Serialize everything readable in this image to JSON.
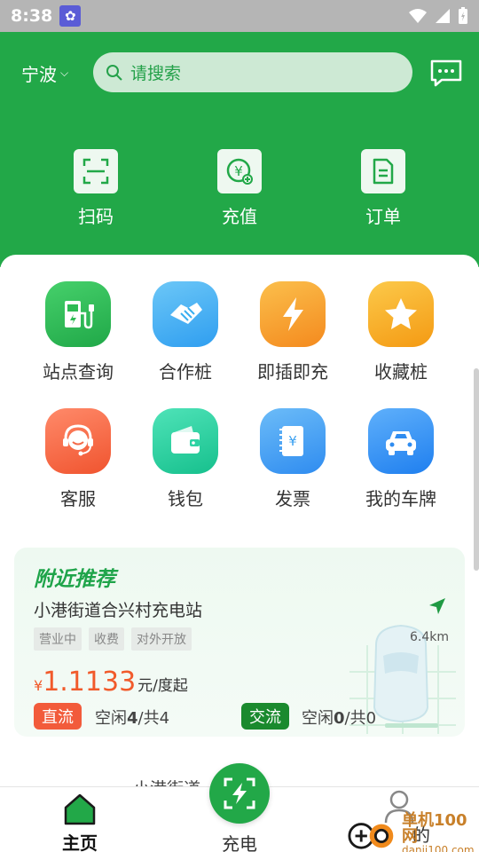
{
  "status_bar": {
    "time": "8:38"
  },
  "header": {
    "city": "宁波",
    "search_placeholder": "请搜索",
    "quick_actions": [
      {
        "label": "扫码",
        "icon": "scan-icon"
      },
      {
        "label": "充值",
        "icon": "recharge-icon"
      },
      {
        "label": "订单",
        "icon": "order-icon"
      }
    ]
  },
  "features": [
    {
      "label": "站点查询",
      "icon": "charging-station-icon",
      "color": "#2fbb54"
    },
    {
      "label": "合作桩",
      "icon": "handshake-icon",
      "color": "#38aef0"
    },
    {
      "label": "即插即充",
      "icon": "lightning-icon",
      "color": "#f7a12a"
    },
    {
      "label": "收藏桩",
      "icon": "star-icon",
      "color": "#f7ad19"
    },
    {
      "label": "客服",
      "icon": "customer-service-icon",
      "color": "#f46a48"
    },
    {
      "label": "钱包",
      "icon": "wallet-icon",
      "color": "#2ed3a4"
    },
    {
      "label": "发票",
      "icon": "invoice-icon",
      "color": "#3aa0f0"
    },
    {
      "label": "我的车牌",
      "icon": "car-icon",
      "color": "#2f8cf0"
    }
  ],
  "nearby": {
    "title": "附近推荐",
    "station_name": "小港街道合兴村充电站",
    "tags": [
      "营业中",
      "收费",
      "对外开放"
    ],
    "distance": "6.4km",
    "price_currency": "¥",
    "price_value": "1.1133",
    "price_unit": "元/度起",
    "dc": {
      "label": "直流",
      "free": "空闲",
      "free_count": "4",
      "total_sep": "/共",
      "total": "4"
    },
    "ac": {
      "label": "交流",
      "free": "空闲",
      "free_count": "0",
      "total_sep": "/共",
      "total": "0"
    }
  },
  "peek_text": "小港街道___电站",
  "bottom_nav": {
    "home": "主页",
    "charge": "充电",
    "mine": "的"
  },
  "watermark": {
    "line1": "单机100网",
    "line2": "danji100.com"
  }
}
